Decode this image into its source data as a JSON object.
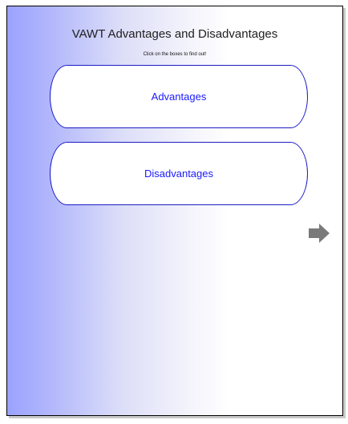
{
  "slide": {
    "title": "VAWT Advantages and Disadvantages",
    "subtitle": "Click on the boxes to find out!"
  },
  "boxes": {
    "advantages_label": "Advantages",
    "disadvantages_label": "Disadvantages"
  },
  "navigation": {
    "next_icon": "right-arrow-icon"
  },
  "colors": {
    "gradient_left": "#9aa2ff",
    "gradient_right": "#ffffff",
    "box_border": "#1c1cc4",
    "box_text": "#1a1aff",
    "arrow": "#7a7a7a"
  }
}
